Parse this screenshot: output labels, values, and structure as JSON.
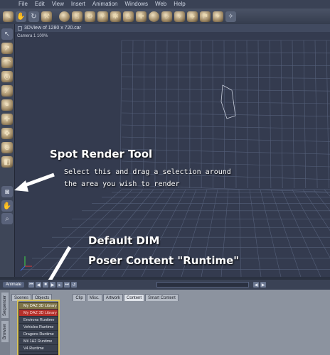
{
  "menu": [
    "File",
    "Edit",
    "View",
    "Insert",
    "Animation",
    "Windows",
    "Web",
    "Help"
  ],
  "toolbar_icons": [
    "pencil-icon",
    "hand-icon",
    "rotate-icon",
    "magnet-icon",
    "sphere-icon",
    "lamp-icon",
    "tool-icon",
    "plug-icon",
    "gear-icon",
    "figure-icon",
    "prop-icon",
    "material-icon",
    "light-icon",
    "camera-icon",
    "scene-icon",
    "group-icon",
    "misc-icon",
    "settings-icon"
  ],
  "viewport": {
    "title": "3DView of 1280 x 720.car",
    "camera": "Camera 1 100%"
  },
  "annotations": {
    "spot_title": "Spot Render Tool",
    "spot_line1": "Select this and drag a selection around",
    "spot_line2": "the area you wish to render",
    "dim_line1": "Default DIM",
    "dim_line2": "Poser Content \"Runtime\""
  },
  "animbar": {
    "animate": "Animate"
  },
  "side_tabs": [
    "Sequencer",
    "Browser"
  ],
  "tabs": [
    "Scenes",
    "Objects",
    "Clip",
    "Misc.",
    "Artwork",
    "Content",
    "Smart Content"
  ],
  "runtime_list": [
    "My DAZ 3D Library Runtime",
    "My DAZ 3D Library",
    "Environs Runtime",
    "Vehicles Runtime",
    "Dragons Runtime",
    "Mil 1&2 Runtime",
    "V4 Runtime"
  ],
  "colors": {
    "accent_highlight": "#7e7448",
    "selected_red": "#b5302b"
  }
}
